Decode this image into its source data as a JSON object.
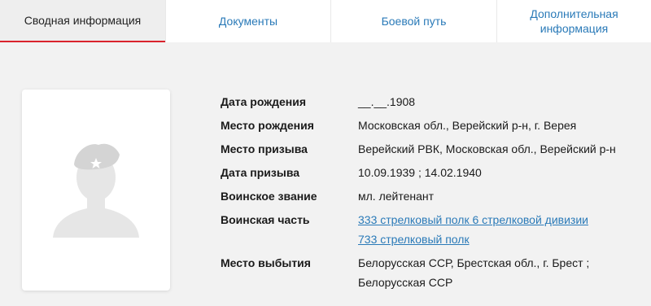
{
  "tabs": [
    {
      "label": "Сводная информация",
      "active": true
    },
    {
      "label": "Документы",
      "active": false
    },
    {
      "label": "Боевой путь",
      "active": false
    },
    {
      "label_line1": "Дополнительная",
      "label_line2": "информация",
      "active": false
    }
  ],
  "photo": {
    "icon": "soldier-silhouette-placeholder"
  },
  "info": {
    "birth_date": {
      "label": "Дата рождения",
      "value": "__.__.1908"
    },
    "birth_place": {
      "label": "Место рождения",
      "value": "Московская обл., Верейский р-н, г. Верея"
    },
    "draft_place": {
      "label": "Место призыва",
      "value": "Верейский РВК, Московская обл., Верейский р-н"
    },
    "draft_date": {
      "label": "Дата призыва",
      "value": "10.09.1939 ; 14.02.1940"
    },
    "rank": {
      "label": "Воинское звание",
      "value": "мл. лейтенант"
    },
    "unit": {
      "label": "Воинская часть",
      "links": [
        "333 стрелковый полк 6 стрелковой дивизии",
        "733 стрелковый полк"
      ]
    },
    "departure_place": {
      "label": "Место выбытия",
      "line1": "Белорусская ССР, Брестская обл., г. Брест ;",
      "line2": "Белорусская ССР"
    }
  },
  "colors": {
    "accent": "#d9232d",
    "link": "#2a7ab8",
    "background": "#f2f2f2"
  }
}
